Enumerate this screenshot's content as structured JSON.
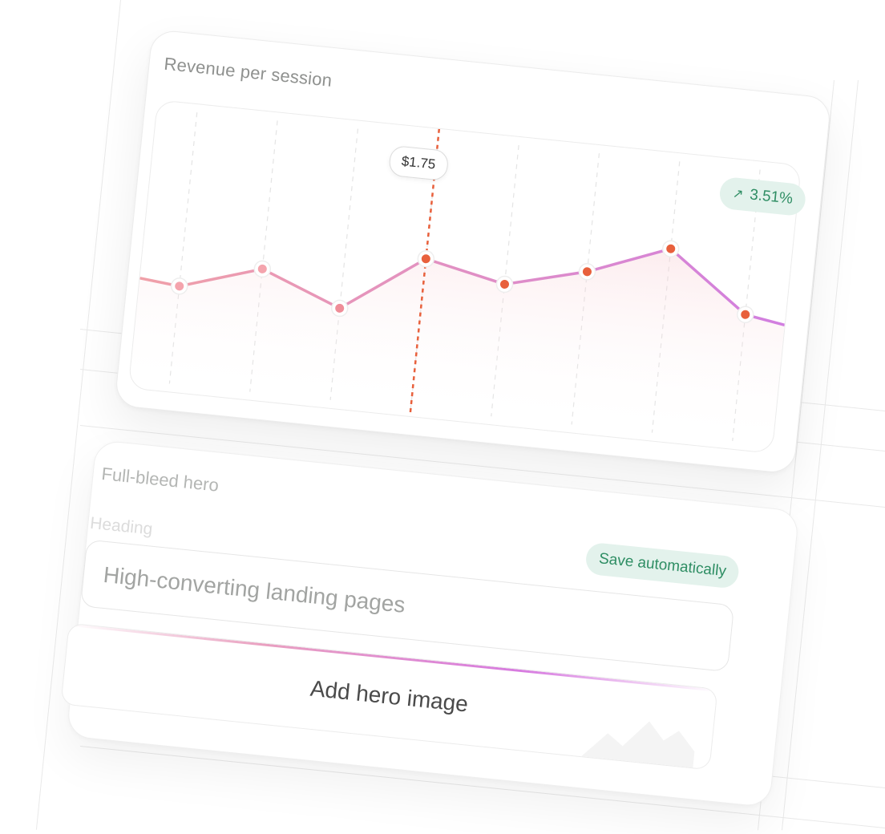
{
  "revenue_card": {
    "title": "Revenue per session",
    "change_badge": {
      "icon": "arrow-up-right-icon",
      "value": "3.51%"
    },
    "tooltip": "$1.75",
    "colors": {
      "line_start": "#f0a0a8",
      "line_end": "#d17ee0",
      "marker": "#e8603c",
      "cursor": "#e8603c",
      "badge_bg": "#e3f2ec",
      "badge_text": "#2f8e64"
    }
  },
  "chart_data": {
    "type": "line",
    "title": "",
    "values": [
      1.3,
      1.52,
      1.25,
      1.75,
      1.6,
      1.78,
      2.05,
      1.55
    ],
    "highlighted_index": 3,
    "highlighted_value": "$1.75",
    "change": "3.51%",
    "grid": "vertical dashed"
  },
  "hero_card": {
    "title": "Full-bleed hero",
    "heading_label": "Heading",
    "autosave_badge": "Save automatically",
    "heading_value": "High-converting landing pages",
    "add_image_label": "Add hero image"
  }
}
